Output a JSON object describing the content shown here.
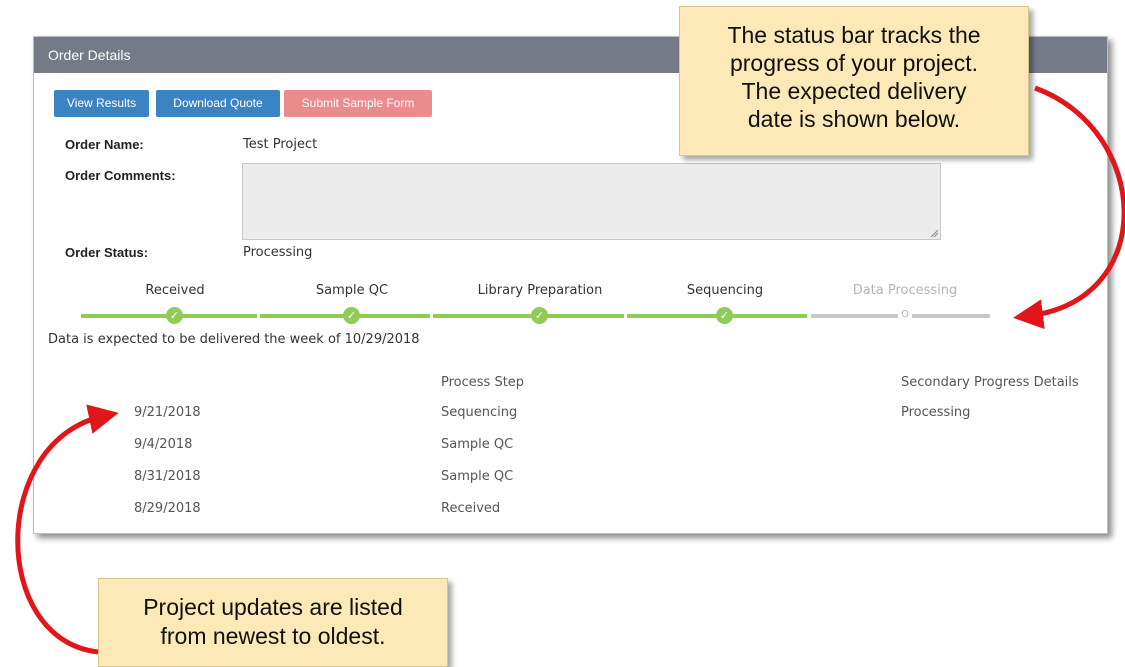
{
  "panel": {
    "title": "Order Details"
  },
  "buttons": {
    "view_results": "View Results",
    "download_quote": "Download Quote",
    "submit_sample_form": "Submit Sample Form"
  },
  "order": {
    "name_label": "Order Name:",
    "name_value": "Test Project",
    "comments_label": "Order Comments:",
    "comments_value": "",
    "status_label": "Order Status:",
    "status_value": "Processing"
  },
  "status_bar": {
    "steps": [
      {
        "label": "Received",
        "state": "complete",
        "icon": "check-icon"
      },
      {
        "label": "Sample QC",
        "state": "complete",
        "icon": "check-icon"
      },
      {
        "label": "Library Preparation",
        "state": "complete",
        "icon": "check-icon"
      },
      {
        "label": "Sequencing",
        "state": "complete",
        "icon": "check-icon"
      },
      {
        "label": "Data Processing",
        "state": "pending",
        "icon": "circle-icon",
        "marker": "O"
      }
    ],
    "complete_color": "#8fcb58",
    "pending_color": "#c8c8c8"
  },
  "delivery_note": "Data is expected to be delivered the week of 10/29/2018",
  "history": {
    "columns": [
      "",
      "Process Step",
      "Secondary Progress Details"
    ],
    "rows": [
      {
        "date": "9/21/2018",
        "step": "Sequencing",
        "details": "Processing"
      },
      {
        "date": "9/4/2018",
        "step": "Sample QC",
        "details": ""
      },
      {
        "date": "8/31/2018",
        "step": "Sample QC",
        "details": ""
      },
      {
        "date": "8/29/2018",
        "step": "Received",
        "details": ""
      }
    ]
  },
  "callouts": {
    "top": [
      "The status bar tracks the",
      "progress of your project.",
      "The expected delivery",
      "date is shown below."
    ],
    "bottom": [
      "Project updates are listed",
      "from newest to oldest."
    ]
  },
  "colors": {
    "header_bg": "#747b86",
    "button_blue": "#3a84c3",
    "button_red": "#ec8b8e",
    "callout_bg": "#fde8b8",
    "arrow": "#e0161b"
  }
}
